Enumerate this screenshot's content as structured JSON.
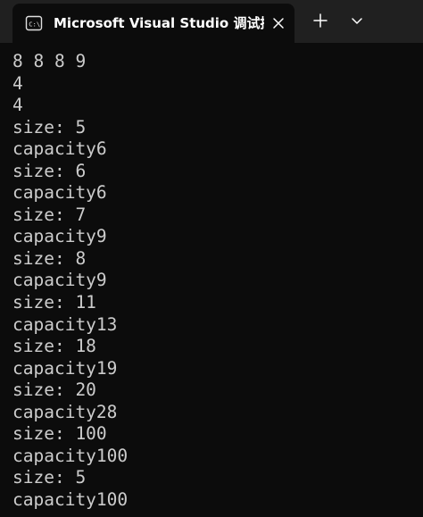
{
  "titlebar": {
    "tab_title": "Microsoft Visual Studio 调试控",
    "tab_icon": "console-app-icon",
    "close_icon": "close-icon",
    "new_tab_icon": "plus-icon",
    "dropdown_icon": "chevron-down-icon"
  },
  "colors": {
    "titlebar_bg": "#202020",
    "console_bg": "#0c0c0c",
    "console_text": "#cccccc",
    "title_text": "#ffffff"
  },
  "console": {
    "lines": [
      "8 8 8 9",
      "4",
      "4",
      "size: 5",
      "capacity6",
      "size: 6",
      "capacity6",
      "size: 7",
      "capacity9",
      "size: 8",
      "capacity9",
      "size: 11",
      "capacity13",
      "size: 18",
      "capacity19",
      "size: 20",
      "capacity28",
      "size: 100",
      "capacity100",
      "size: 5",
      "capacity100"
    ]
  }
}
